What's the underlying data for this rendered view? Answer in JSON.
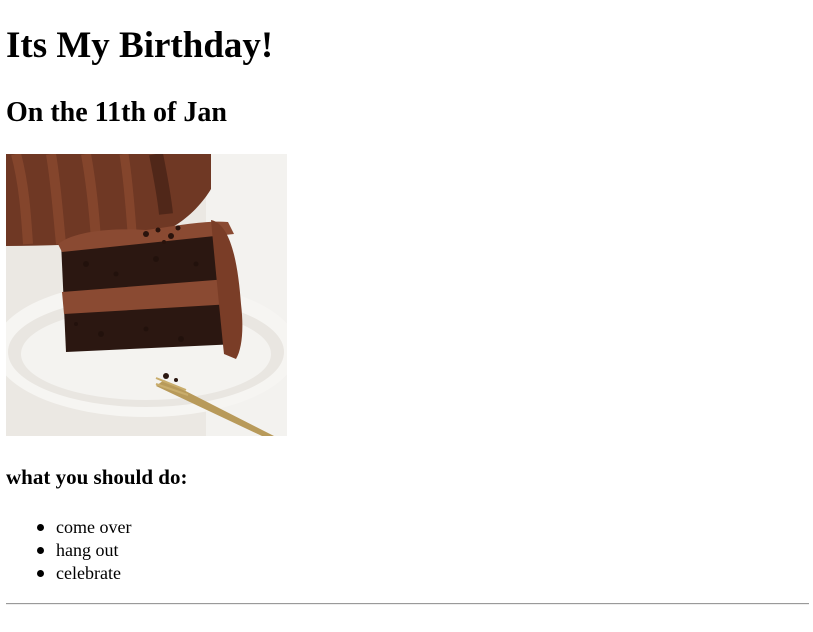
{
  "page": {
    "title": "Its My Birthday!",
    "subtitle": "On the 11th of Jan",
    "image_alt": "slice of chocolate layer cake on a white plate with a fork",
    "todo_heading": "what you should do:",
    "todo_items": [
      "come over",
      "hang out",
      "celebrate"
    ]
  },
  "colors": {
    "text": "#000000",
    "background": "#ffffff",
    "rule": "#9a9a9a",
    "cake_dark": "#2b1711",
    "frosting": "#8a4a32",
    "plate": "#f2f0ec"
  }
}
